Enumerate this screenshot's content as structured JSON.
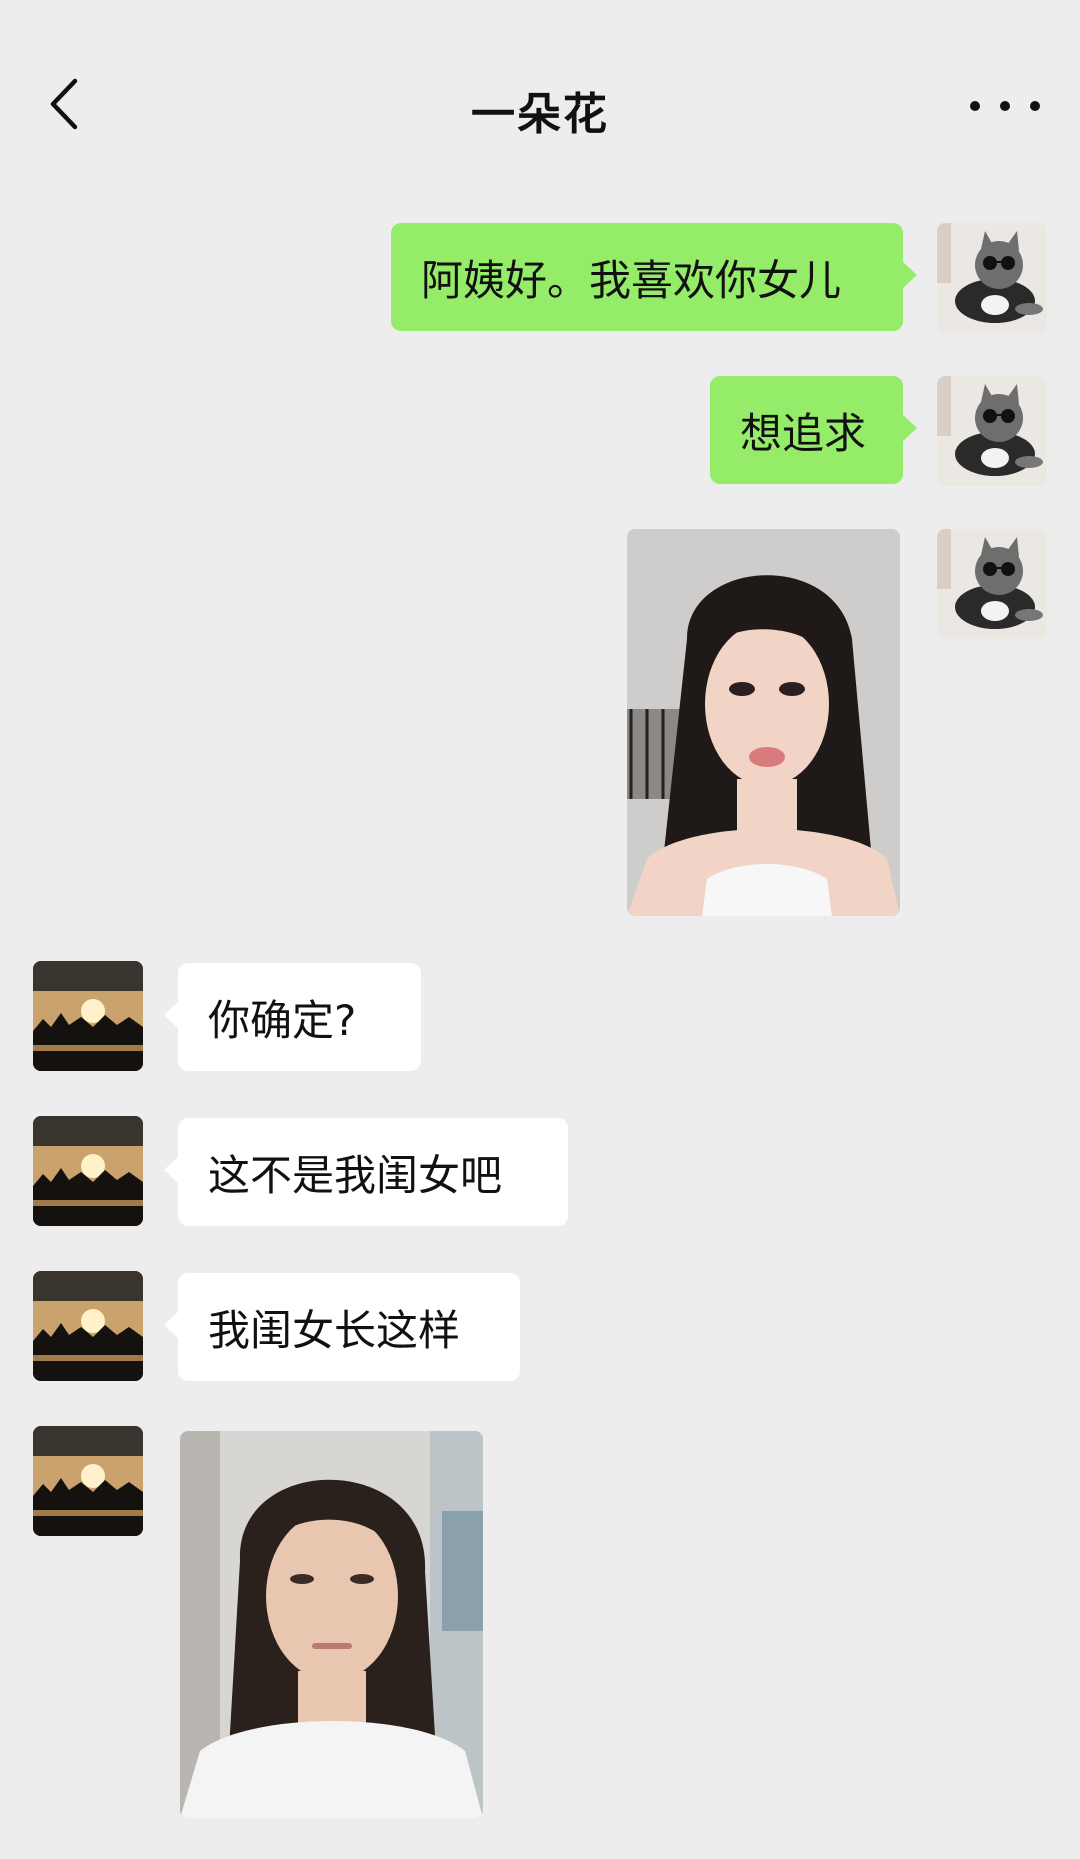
{
  "header": {
    "title": "一朵花",
    "back_icon": "chevron-left-icon",
    "more_icon": "more-dots-icon"
  },
  "colors": {
    "background": "#ededed",
    "sent_bubble": "#95ec69",
    "received_bubble": "#ffffff"
  },
  "messages": [
    {
      "side": "right",
      "type": "text",
      "text": "阿姨好。我喜欢你女儿"
    },
    {
      "side": "right",
      "type": "text",
      "text": "想追求"
    },
    {
      "side": "right",
      "type": "image",
      "image": "portrait-photo"
    },
    {
      "side": "left",
      "type": "text",
      "text": "你确定?"
    },
    {
      "side": "left",
      "type": "text",
      "text": "这不是我闺女吧"
    },
    {
      "side": "left",
      "type": "text",
      "text": "我闺女长这样"
    },
    {
      "side": "left",
      "type": "image",
      "image": "portrait-photo"
    }
  ]
}
